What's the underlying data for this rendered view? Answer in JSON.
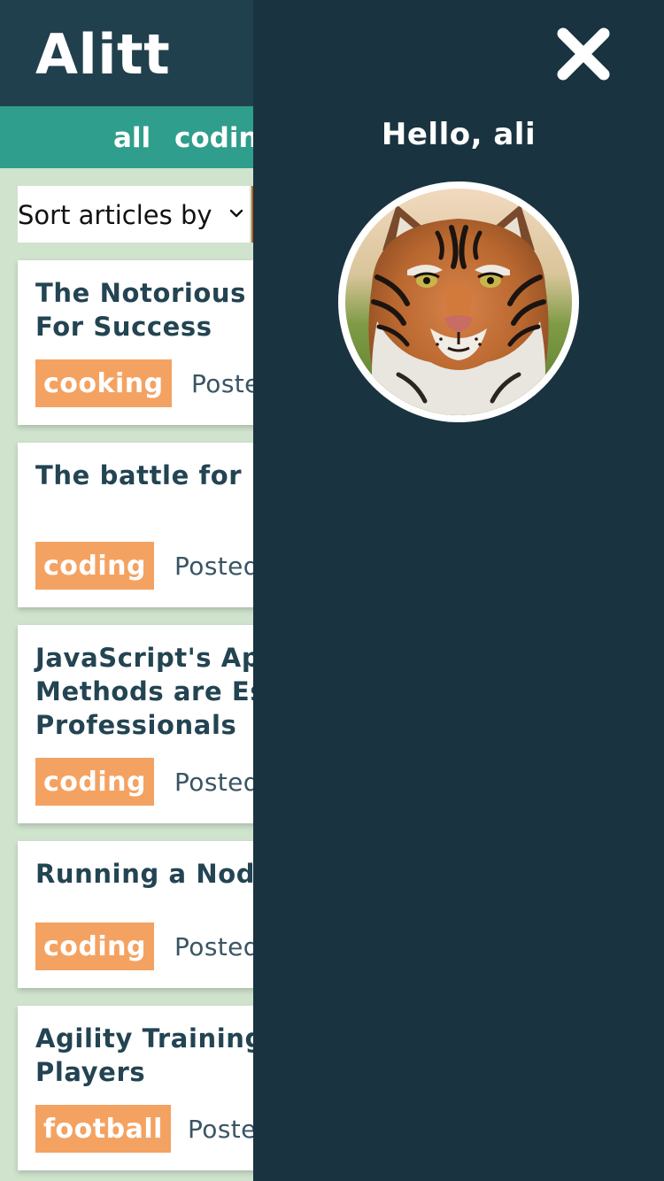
{
  "app": {
    "title": "Alitt"
  },
  "topics": {
    "items": [
      {
        "label": "all"
      },
      {
        "label": "coding"
      }
    ]
  },
  "sort": {
    "label": "Sort articles by"
  },
  "articles": [
    {
      "title": "The Notorious MSG's Secret Formula For Success",
      "topic": "cooking",
      "posted": "Posted"
    },
    {
      "title": "The battle for Node.js has only begun",
      "topic": "coding",
      "posted": "Posted"
    },
    {
      "title": "JavaScript's Apply, Call, and Bind Methods are Essential for JavaScript Professionals",
      "topic": "coding",
      "posted": "Posted"
    },
    {
      "title": "Running a Node App on Amazon ECS",
      "topic": "coding",
      "posted": "Posted"
    },
    {
      "title": "Agility Training Drills For Football Players",
      "topic": "football",
      "posted": "Posted"
    }
  ],
  "drawer": {
    "greeting": "Hello, ali",
    "avatar_icon": "tiger-avatar-image",
    "close_icon": "close-icon"
  },
  "colors": {
    "header": "#21404e",
    "topic_bar": "#2f9e8c",
    "background": "#cfe3cd",
    "tag": "#f4a262",
    "drawer": "#1a3340",
    "title_text": "#234452"
  }
}
